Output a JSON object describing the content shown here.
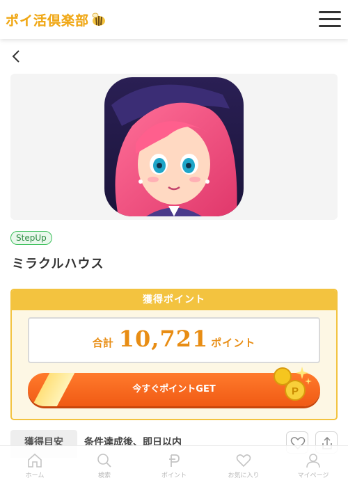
{
  "header": {
    "logo_text": "ポイ活倶楽部"
  },
  "badge": "StepUp",
  "title": "ミラクルハウス",
  "points": {
    "heading": "獲得ポイント",
    "total_label": "合計",
    "total_value": "10,721",
    "unit": "ポイント",
    "cta": "今すぐポイントGET"
  },
  "meta": {
    "label": "獲得目安",
    "value": "条件達成後、即日以内"
  },
  "tabs": [
    {
      "label": "ホーム",
      "icon": "home-icon"
    },
    {
      "label": "検索",
      "icon": "search-icon"
    },
    {
      "label": "ポイント",
      "icon": "point-icon"
    },
    {
      "label": "お気に入り",
      "icon": "heart-icon"
    },
    {
      "label": "マイページ",
      "icon": "user-icon"
    }
  ],
  "colors": {
    "accent": "#f3c33f",
    "cta": "#f05a14",
    "points": "#e88d14",
    "badge": "#3bbf5a"
  }
}
